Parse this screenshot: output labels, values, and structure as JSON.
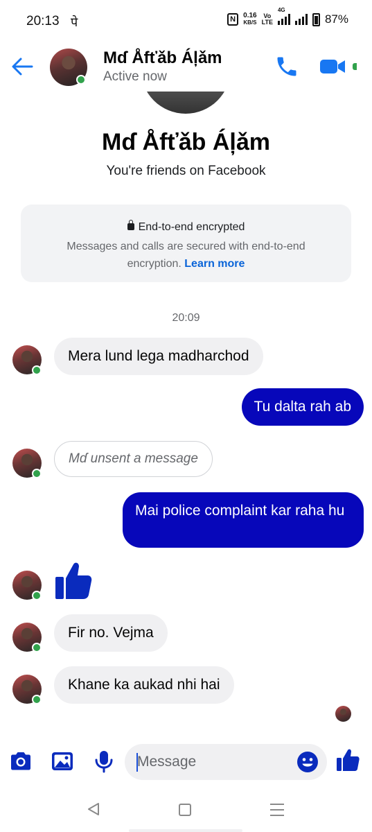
{
  "status_bar": {
    "time": "20:13",
    "notification_glyph": "पे",
    "network_speed_value": "0.16",
    "network_speed_unit": "KB/S",
    "volte_top": "Vo",
    "volte_bottom": "LTE",
    "network_type": "4G",
    "battery": "87%"
  },
  "header": {
    "contact_name": "Mɗ Åfťǎb Áļǎm",
    "status": "Active now",
    "accent_color": "#1877f2"
  },
  "intro": {
    "name": "Mɗ Åfťǎb Áļǎm",
    "friends_text": "You're friends on Facebook",
    "encryption_title": "End-to-end encrypted",
    "encryption_body": "Messages and calls are secured with end-to-end encryption.",
    "learn_more": "Learn more"
  },
  "conversation": {
    "timestamp": "20:09",
    "messages": [
      {
        "direction": "incoming",
        "text": "Mera lund lega madharchod"
      },
      {
        "direction": "outgoing",
        "text": "Tu dalta rah ab"
      },
      {
        "direction": "incoming",
        "type": "unsent",
        "text": "Mɗ unsent a message"
      },
      {
        "direction": "outgoing",
        "text": "Mai police complaint kar raha hu"
      },
      {
        "direction": "incoming",
        "type": "sticker",
        "icon": "thumbs-up-icon"
      },
      {
        "direction": "incoming",
        "text": "Fir no. Vejma"
      },
      {
        "direction": "incoming",
        "text": "Khane ka aukad nhi hai"
      }
    ],
    "outgoing_bubble_color": "#0707ba",
    "incoming_bubble_color": "#f0f0f2"
  },
  "composer": {
    "placeholder": "Message",
    "icon_color": "#0a2bbd"
  }
}
